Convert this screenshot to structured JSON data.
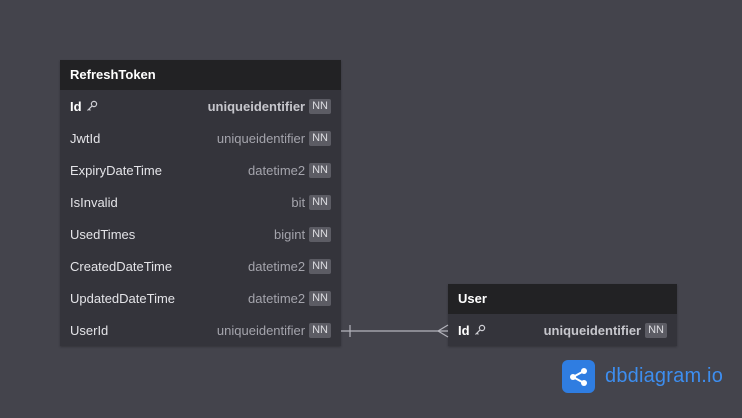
{
  "refresh_token_table": {
    "title": "RefreshToken",
    "fields": [
      {
        "name": "Id",
        "type": "uniqueidentifier",
        "badge": "NN",
        "primary_key": true,
        "icon": "key-icon"
      },
      {
        "name": "JwtId",
        "type": "uniqueidentifier",
        "badge": "NN"
      },
      {
        "name": "ExpiryDateTime",
        "type": "datetime2",
        "badge": "NN"
      },
      {
        "name": "IsInvalid",
        "type": "bit",
        "badge": "NN"
      },
      {
        "name": "UsedTimes",
        "type": "bigint",
        "badge": "NN"
      },
      {
        "name": "CreatedDateTime",
        "type": "datetime2",
        "badge": "NN"
      },
      {
        "name": "UpdatedDateTime",
        "type": "datetime2",
        "badge": "NN"
      },
      {
        "name": "UserId",
        "type": "uniqueidentifier",
        "badge": "NN"
      }
    ]
  },
  "user_table": {
    "title": "User",
    "fields": [
      {
        "name": "Id",
        "type": "uniqueidentifier",
        "badge": "NN",
        "primary_key": true,
        "icon": "key-icon"
      }
    ]
  },
  "relationship": {
    "from": "RefreshToken.UserId",
    "to": "User.Id",
    "from_marker": "one",
    "to_marker": "many"
  },
  "brand": {
    "name": "dbdiagram.io",
    "icon": "share-nodes-icon",
    "color": "#2f7de1"
  },
  "colors": {
    "canvas": "#44444c",
    "table_header": "#222224",
    "table_body": "#34343b"
  }
}
